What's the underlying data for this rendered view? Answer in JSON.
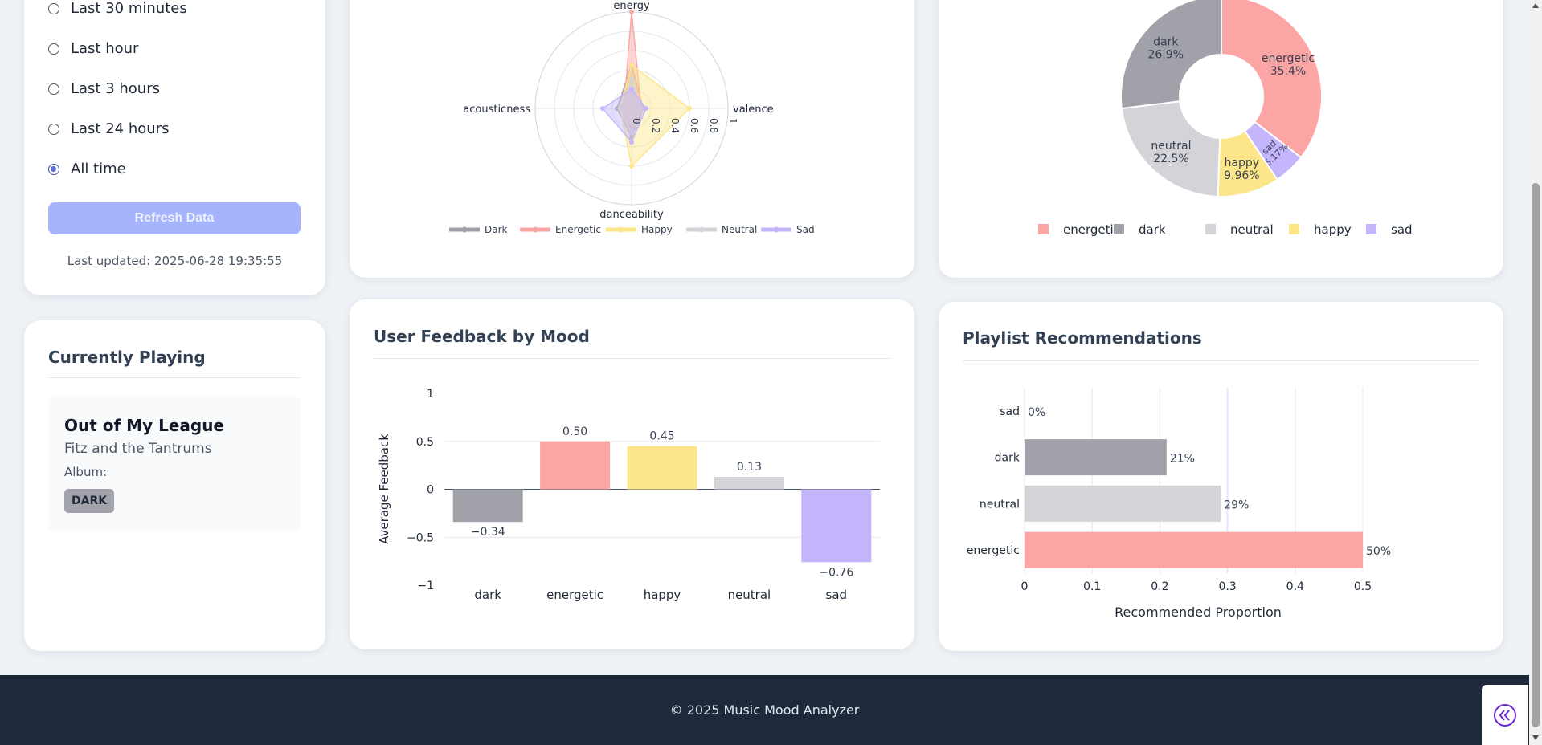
{
  "filter": {
    "options": [
      {
        "label": "Last 30 minutes",
        "checked": false
      },
      {
        "label": "Last hour",
        "checked": false
      },
      {
        "label": "Last 3 hours",
        "checked": false
      },
      {
        "label": "Last 24 hours",
        "checked": false
      },
      {
        "label": "All time",
        "checked": true
      }
    ],
    "refresh_label": "Refresh Data",
    "last_updated": "Last updated: 2025-06-28 19:35:55"
  },
  "now_playing": {
    "heading": "Currently Playing",
    "title": "Out of My League",
    "artist": "Fitz and the Tantrums",
    "album_label": "Album:",
    "mood_badge": "DARK"
  },
  "colors": {
    "dark": "#a1a1aa",
    "energetic": "#fca5a5",
    "happy": "#fde68a",
    "neutral": "#d4d4d8",
    "sad": "#c4b5fd",
    "accent": "#a5b4fc",
    "footer_bg": "#1e293b"
  },
  "chart_data": [
    {
      "type": "radar",
      "axes": [
        "energy",
        "valence",
        "danceability",
        "acousticness"
      ],
      "radial_ticks": [
        "0",
        "0.2",
        "0.4",
        "0.6",
        "0.8",
        "1"
      ],
      "series": [
        {
          "name": "Dark",
          "values": [
            0.45,
            0.12,
            0.3,
            0.15
          ]
        },
        {
          "name": "Energetic",
          "values": [
            1.0,
            0.1,
            0.2,
            0.08
          ]
        },
        {
          "name": "Happy",
          "values": [
            0.45,
            0.6,
            0.6,
            0.12
          ]
        },
        {
          "name": "Neutral",
          "values": [
            0.3,
            0.1,
            0.25,
            0.1
          ]
        },
        {
          "name": "Sad",
          "values": [
            0.2,
            0.15,
            0.35,
            0.3
          ]
        }
      ]
    },
    {
      "type": "pie",
      "slices": [
        {
          "label": "energetic",
          "value": 35.4,
          "text": "35.4%"
        },
        {
          "label": "sad",
          "value": 5.17,
          "text": "5.17%"
        },
        {
          "label": "happy",
          "value": 9.96,
          "text": "9.96%"
        },
        {
          "label": "neutral",
          "value": 22.5,
          "text": "22.5%"
        },
        {
          "label": "dark",
          "value": 26.9,
          "text": "26.9%"
        }
      ],
      "legend": [
        "energetic",
        "dark",
        "neutral",
        "happy",
        "sad"
      ]
    },
    {
      "type": "bar",
      "title": "User Feedback by Mood",
      "ylabel": "Average Feedback",
      "categories": [
        "dark",
        "energetic",
        "happy",
        "neutral",
        "sad"
      ],
      "values": [
        -0.34,
        0.5,
        0.45,
        0.13,
        -0.76
      ],
      "labels": [
        "−0.34",
        "0.50",
        "0.45",
        "0.13",
        "−0.76"
      ],
      "ylim": [
        -1,
        1
      ],
      "yticks": [
        "1",
        "0.5",
        "0",
        "−0.5",
        "−1"
      ]
    },
    {
      "type": "bar",
      "orientation": "horizontal",
      "title": "Playlist Recommendations",
      "xlabel": "Recommended Proportion",
      "categories": [
        "sad",
        "dark",
        "neutral",
        "energetic"
      ],
      "values": [
        0,
        0.21,
        0.29,
        0.5
      ],
      "labels": [
        "0%",
        "21%",
        "29%",
        "50%"
      ],
      "xlim": [
        0,
        0.5
      ],
      "xticks": [
        "0",
        "0.1",
        "0.2",
        "0.3",
        "0.4",
        "0.5"
      ]
    }
  ],
  "footer": {
    "text": "© 2025 Music Mood Analyzer"
  }
}
